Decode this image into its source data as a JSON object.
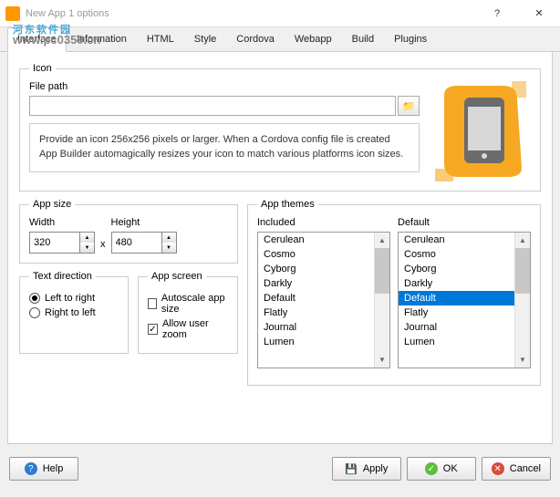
{
  "window": {
    "title": "New App 1 options"
  },
  "watermark": {
    "main": "河东软件园",
    "sub": "www.pc0359.cn"
  },
  "tabs": {
    "items": [
      "Interface",
      "Information",
      "HTML",
      "Style",
      "Cordova",
      "Webapp",
      "Build",
      "Plugins"
    ],
    "active": 0
  },
  "icon": {
    "legend": "Icon",
    "filepath_label": "File path",
    "filepath_value": "",
    "hint": "Provide an icon 256x256 pixels or larger. When a Cordova config file is created App Builder automagically resizes your icon to match various platforms icon sizes."
  },
  "app_size": {
    "legend": "App size",
    "width_label": "Width",
    "width_value": "320",
    "height_label": "Height",
    "height_value": "480",
    "x": "x"
  },
  "text_direction": {
    "legend": "Text direction",
    "ltr_label": "Left to right",
    "rtl_label": "Right to left",
    "selected": "ltr"
  },
  "app_screen": {
    "legend": "App screen",
    "autoscale_label": "Autoscale app size",
    "autoscale_checked": false,
    "zoom_label": "Allow user zoom",
    "zoom_checked": true
  },
  "app_themes": {
    "legend": "App themes",
    "included_label": "Included",
    "default_label": "Default",
    "included_items": [
      "Cerulean",
      "Cosmo",
      "Cyborg",
      "Darkly",
      "Default",
      "Flatly",
      "Journal",
      "Lumen"
    ],
    "default_items": [
      "Cerulean",
      "Cosmo",
      "Cyborg",
      "Darkly",
      "Default",
      "Flatly",
      "Journal",
      "Lumen"
    ],
    "default_selected": 4
  },
  "footer": {
    "help": "Help",
    "apply": "Apply",
    "ok": "OK",
    "cancel": "Cancel"
  }
}
